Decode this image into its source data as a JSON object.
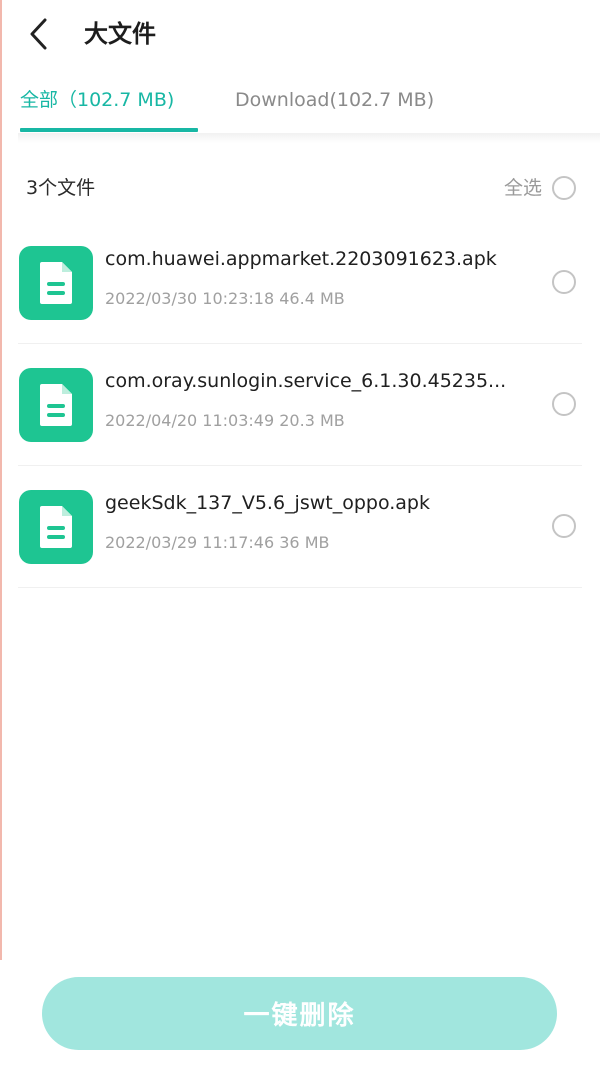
{
  "header": {
    "title": "大文件",
    "back_icon": "chevron-left-icon"
  },
  "tabs": [
    {
      "label": "全部（102.7 MB)",
      "active": true
    },
    {
      "label": "Download(102.7 MB)",
      "active": false
    }
  ],
  "list_header": {
    "count_label": "3个文件",
    "select_all_label": "全选"
  },
  "files": [
    {
      "name": "com.huawei.appmarket.2203091623.apk",
      "meta": "2022/03/30 10:23:18 46.4 MB",
      "icon": "document-icon"
    },
    {
      "name": "com.oray.sunlogin.service_6.1.30.45235...",
      "meta": "2022/04/20 11:03:49 20.3 MB",
      "icon": "document-icon"
    },
    {
      "name": "geekSdk_137_V5.6_jswt_oppo.apk",
      "meta": "2022/03/29 11:17:46 36 MB",
      "icon": "document-icon"
    }
  ],
  "footer": {
    "delete_label": "一键删除"
  },
  "colors": {
    "accent": "#18b7a4",
    "file_icon_bg": "#1ec592",
    "button_bg": "#a1e6de"
  }
}
